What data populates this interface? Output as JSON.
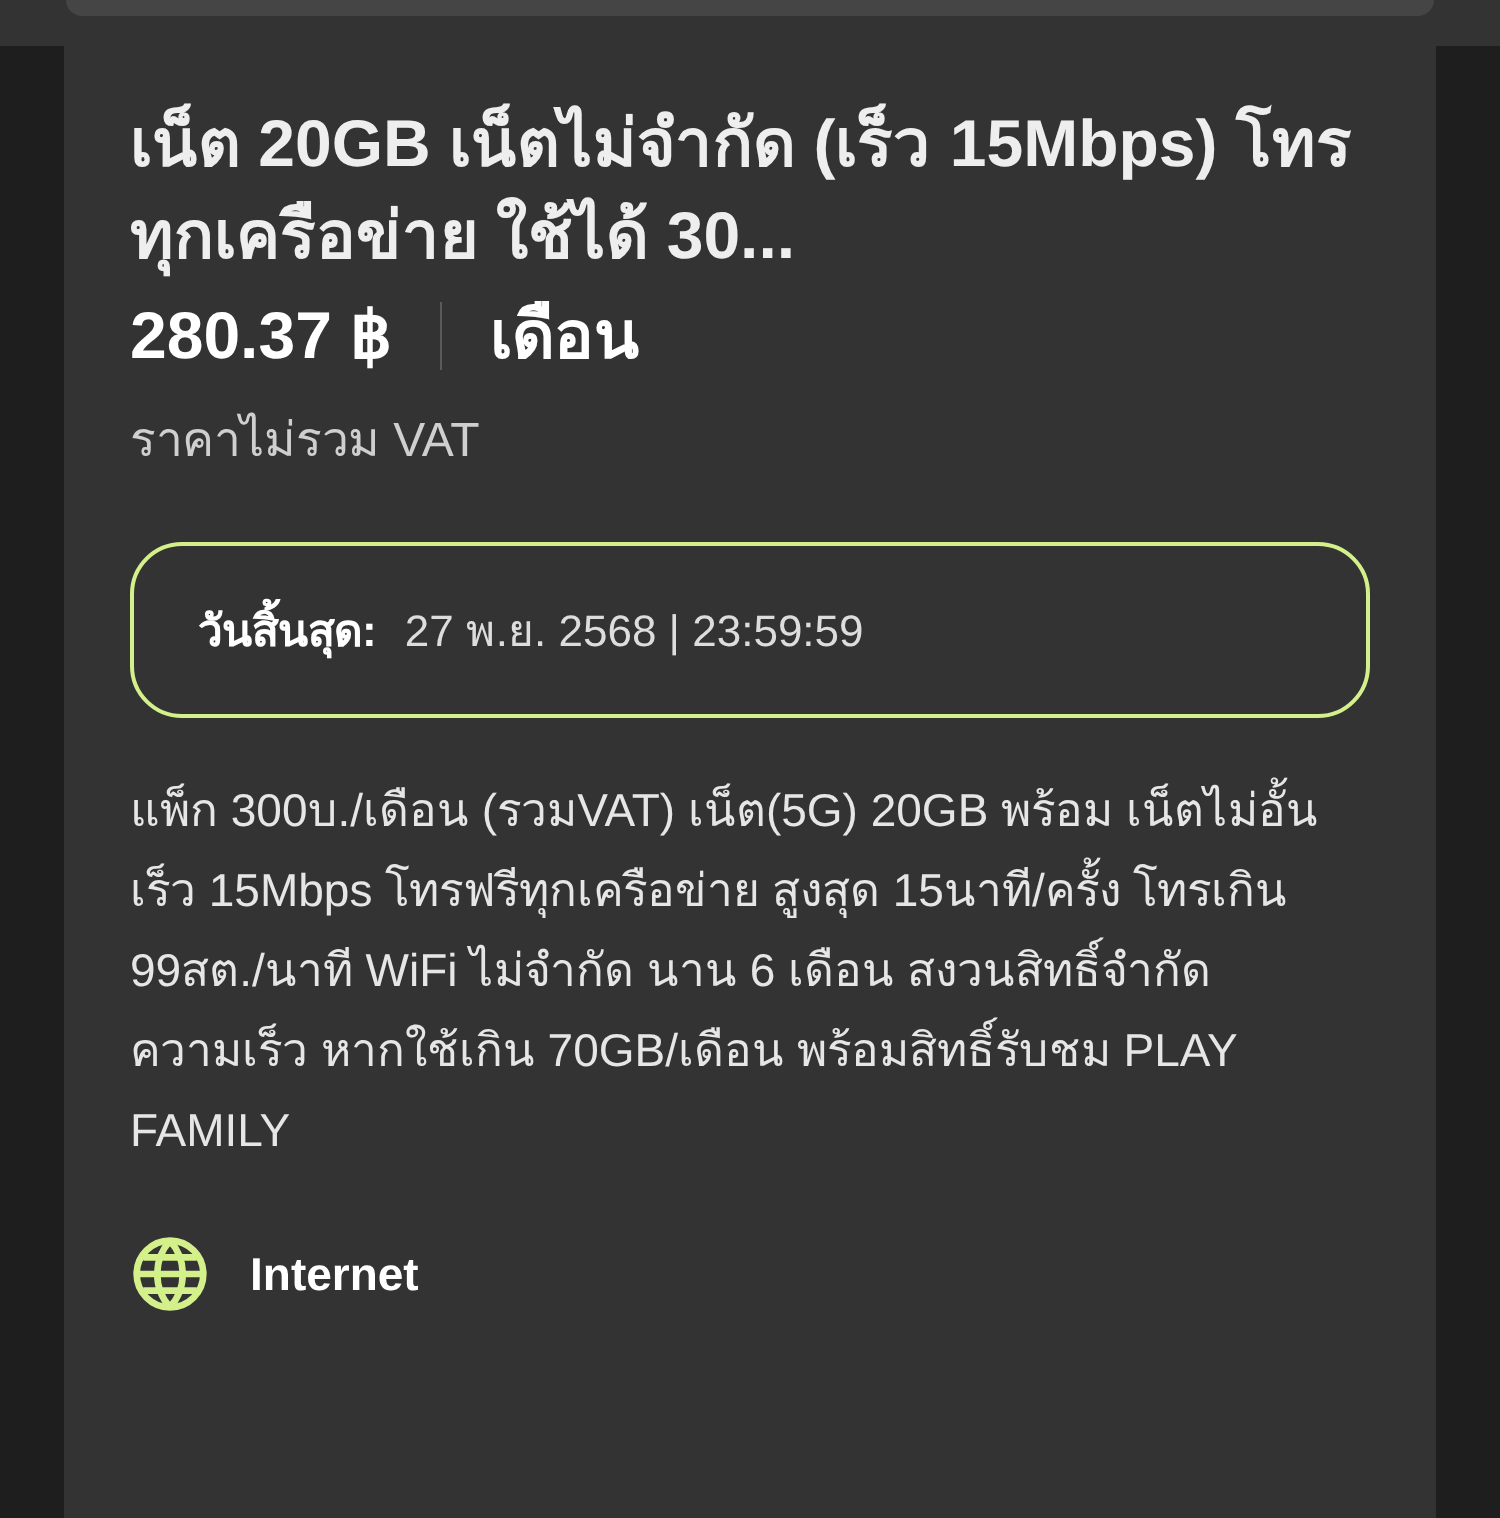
{
  "title": "เน็ต 20GB เน็ตไม่จำกัด (เร็ว 15Mbps) โทรทุกเครือข่าย ใช้ได้ 30...",
  "price": {
    "amount": "280.37 ฿",
    "period": "เดือน"
  },
  "vat_note": "ราคาไม่รวม VAT",
  "expiry": {
    "label": "วันสิ้นสุด:",
    "value": "27 พ.ย. 2568 | 23:59:59"
  },
  "description": "แพ็ก 300บ./เดือน (รวมVAT) เน็ต(5G) 20GB พร้อม เน็ตไม่อั้นเร็ว 15Mbps โทรฟรีทุกเครือข่าย สูงสุด 15นาที/ครั้ง โทรเกิน 99สต./นาที WiFi ไม่จำกัด นาน 6 เดือน สงวนสิทธิ์จำกัดความเร็ว หากใช้เกิน 70GB/เดือน พร้อมสิทธิ์รับชม PLAY FAMILY",
  "features": [
    {
      "kind": "internet",
      "label": "Internet"
    }
  ]
}
